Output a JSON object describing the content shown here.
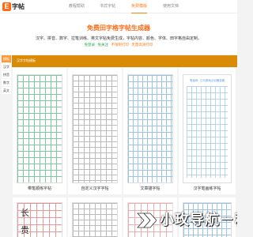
{
  "logo": {
    "mark": "E",
    "text": "字帖"
  },
  "nav": [
    {
      "label": "教程帮助",
      "active": false
    },
    {
      "label": "书式字帖",
      "active": false
    },
    {
      "label": "免费模版",
      "active": true
    },
    {
      "label": "使用文档",
      "active": false
    }
  ],
  "hero": {
    "title": "免费田字格字帖生成器",
    "desc": "汉字、拼音、数字、拉笔训练、英文字帖免费生成，字帖内容、颜色、字体、田字格自由定制。",
    "tags": [
      "免登录",
      "免关注",
      "不限制打印",
      "无量高清打印"
    ]
  },
  "sidebar": [
    "模板",
    "汉字",
    "拼音",
    "数字",
    "英文"
  ],
  "category_label": "汉字字帖模板",
  "cards": [
    {
      "label": "带笔顺练字帖"
    },
    {
      "label": "自定义汉字字帖"
    },
    {
      "label": "文章描字帖"
    },
    {
      "label": "汉字笔画练字帖",
      "paper_head": "笔画练: 江河湖海点划横竖撇"
    }
  ],
  "bottom_chars": [
    "长",
    "贵"
  ],
  "watermark": "小玫导航－秒收",
  "colors": {
    "accent": "#ff6a13",
    "category_bar": "#d98b06",
    "tag_green": "#27a844",
    "tag_orange": "#ff7e1b"
  }
}
